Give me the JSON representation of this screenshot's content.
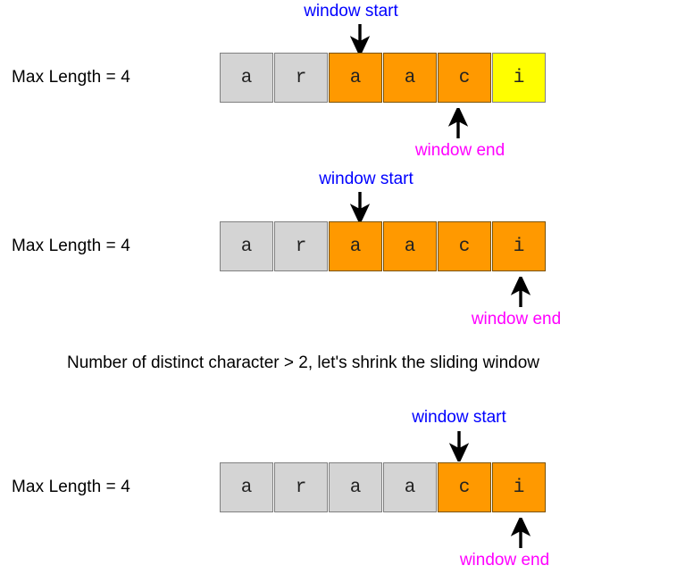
{
  "diagram": {
    "title_note": "Number of distinct character > 2, let's shrink the sliding window",
    "labels": {
      "window_start": "window start",
      "window_end": "window end",
      "max_length": "Max Length = 4"
    },
    "colors": {
      "window_cell": "#ff9900",
      "inactive_cell": "#d4d4d4",
      "highlight_cell": "#ffff00",
      "start_label": "#0000ff",
      "end_label": "#ff00ff",
      "cell_border": "#808080",
      "text": "#000000"
    },
    "rows": [
      {
        "max_length": "Max Length = 4",
        "cells": [
          {
            "char": "a",
            "state": "inactive"
          },
          {
            "char": "r",
            "state": "inactive"
          },
          {
            "char": "a",
            "state": "window"
          },
          {
            "char": "a",
            "state": "window"
          },
          {
            "char": "c",
            "state": "window"
          },
          {
            "char": "i",
            "state": "highlight"
          }
        ],
        "start_index": 2,
        "end_index": 4,
        "start_label": "window start",
        "end_label": "window end"
      },
      {
        "max_length": "Max Length = 4",
        "cells": [
          {
            "char": "a",
            "state": "inactive"
          },
          {
            "char": "r",
            "state": "inactive"
          },
          {
            "char": "a",
            "state": "window"
          },
          {
            "char": "a",
            "state": "window"
          },
          {
            "char": "c",
            "state": "window"
          },
          {
            "char": "i",
            "state": "window"
          }
        ],
        "start_index": 2,
        "end_index": 5,
        "start_label": "window start",
        "end_label": "window end"
      },
      {
        "max_length": "Max Length = 4",
        "cells": [
          {
            "char": "a",
            "state": "inactive"
          },
          {
            "char": "r",
            "state": "inactive"
          },
          {
            "char": "a",
            "state": "inactive"
          },
          {
            "char": "a",
            "state": "inactive"
          },
          {
            "char": "c",
            "state": "window"
          },
          {
            "char": "i",
            "state": "window"
          }
        ],
        "start_index": 4,
        "end_index": 5,
        "start_label": "window start",
        "end_label": "window end"
      }
    ]
  }
}
